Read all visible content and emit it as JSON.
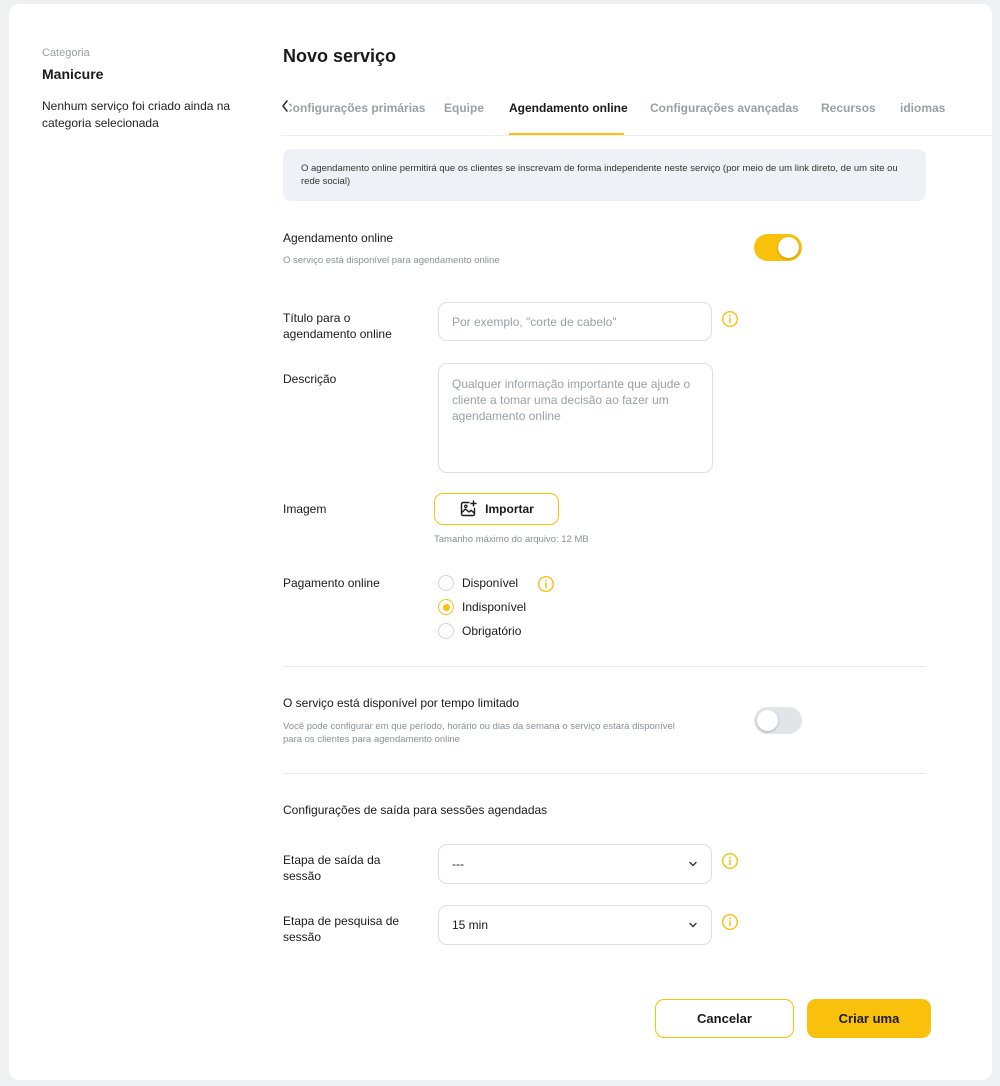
{
  "sidebar": {
    "caption": "Categoria",
    "category": "Manicure",
    "empty_text": "Nenhum serviço foi criado ainda na categoria selecionada"
  },
  "header": {
    "title": "Novo serviço",
    "tabs": [
      {
        "label": "Configurações primárias",
        "active": false
      },
      {
        "label": "Equipe",
        "active": false
      },
      {
        "label": "Agendamento online",
        "active": true
      },
      {
        "label": "Configurações avançadas",
        "active": false
      },
      {
        "label": "Recursos",
        "active": false
      },
      {
        "label": "idiomas",
        "active": false
      }
    ]
  },
  "banner": {
    "text": "O agendamento online permitirá que os clientes se inscrevam de forma independente neste serviço (por meio de um link direto, de um site ou rede social)"
  },
  "online_booking": {
    "label": "Agendamento online",
    "sublabel": "O serviço está disponível para agendamento online",
    "enabled": true
  },
  "form": {
    "title_label": "Título para o agendamento online",
    "title_placeholder": "Por exemplo, \"corte de cabelo\"",
    "title_value": "",
    "description_label": "Descrição",
    "description_placeholder": "Qualquer informação importante que ajude o cliente a tomar uma decisão ao fazer um agendamento online",
    "description_value": "",
    "image_label": "Imagem",
    "import_label": "Importar",
    "max_size_hint": "Tamanho máximo do arquivo: 12 MB",
    "payment_label": "Pagamento online",
    "payment_options": [
      {
        "label": "Disponível",
        "checked": false
      },
      {
        "label": "Indisponível",
        "checked": true
      },
      {
        "label": "Obrigatório",
        "checked": false
      }
    ]
  },
  "limited_time": {
    "label": "O serviço está disponível por tempo limitado",
    "sublabel": "Você pode configurar em que período, horário ou dias da semana o serviço estará disponível para os clientes para agendamento online",
    "enabled": false
  },
  "exit_settings": {
    "heading": "Configurações de saída para sessões agendadas",
    "exit_stage_label": "Etapa de saída da sessão",
    "exit_stage_value": "---",
    "search_stage_label": "Etapa de pesquisa de sessão",
    "search_stage_value": "15 min"
  },
  "actions": {
    "cancel": "Cancelar",
    "create": "Criar uma"
  },
  "colors": {
    "accent": "#f9c10b",
    "banner_bg": "#eef1f5",
    "page_bg": "#eef0f2"
  },
  "icons": [
    "chevron-left-icon",
    "info-icon",
    "image-add-icon",
    "chevron-down-icon"
  ]
}
